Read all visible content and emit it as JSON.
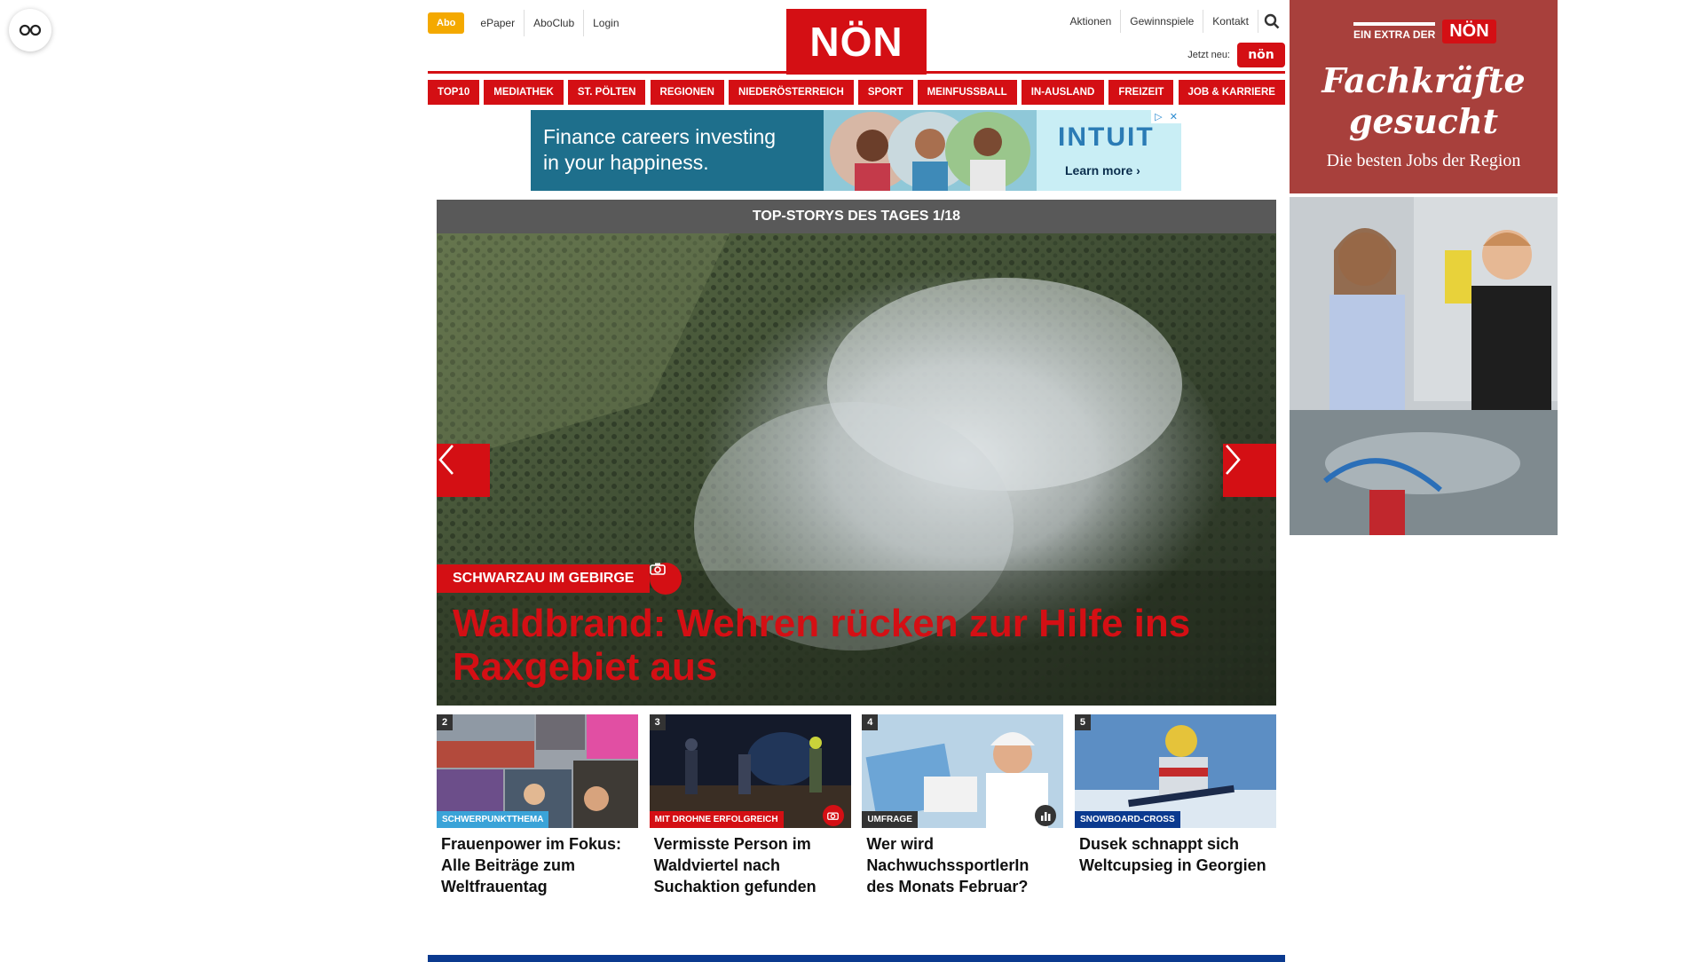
{
  "util": {
    "abo": "Abo",
    "epaper": "ePaper",
    "aboclub": "AboClub",
    "login": "Login",
    "aktionen": "Aktionen",
    "gewinnspiele": "Gewinnspiele",
    "kontakt": "Kontakt",
    "search_icon": "search-icon",
    "jetzt_neu": "Jetzt neu:"
  },
  "logo": "NÖN",
  "nav": [
    "TOP10",
    "MEDIATHEK",
    "ST. PÖLTEN",
    "REGIONEN",
    "NIEDERÖSTERREICH",
    "SPORT",
    "MEINFUSSBALL",
    "IN-AUSLAND",
    "FREIZEIT",
    "JOB & KARRIERE"
  ],
  "banner": {
    "line1": "Finance careers investing",
    "line2": "in your happiness.",
    "brand": "INTUIT",
    "cta": "Learn more ›"
  },
  "top_stories": {
    "heading": "TOP-STORYS DES TAGES 1/18",
    "tag": "SCHWARZAU IM GEBIRGE",
    "title": "Waldbrand: Wehren rücken zur Hilfe ins Raxgebiet aus"
  },
  "cards": [
    {
      "num": "2",
      "category": "SCHWERPUNKTTHEMA",
      "title": "Frauenpower im Fokus: Alle Beiträge zum Weltfrauentag",
      "cat_color": "#3aa3d8"
    },
    {
      "num": "3",
      "category": "MIT DROHNE ERFOLGREICH",
      "title": "Vermisste Person im Waldviertel nach Suchaktion gefunden",
      "cat_color": "#d40f14"
    },
    {
      "num": "4",
      "category": "UMFRAGE",
      "title": "Wer wird NachwuchssportlerIn des Monats Februar?",
      "cat_color": "#333333"
    },
    {
      "num": "5",
      "category": "SNOWBOARD-CROSS",
      "title": "Dusek schnappt sich Weltcupsieg in Georgien",
      "cat_color": "#0b3a8f"
    }
  ],
  "side_ad": {
    "extra": "EIN EXTRA DER",
    "logo": "NÖN",
    "headline1": "Fachkräfte",
    "headline2": "gesucht",
    "sub": "Die besten Jobs der Region"
  },
  "colors": {
    "brand_red": "#d40f14",
    "abo_orange": "#f4a900",
    "footer_blue": "#0b3a8f"
  }
}
